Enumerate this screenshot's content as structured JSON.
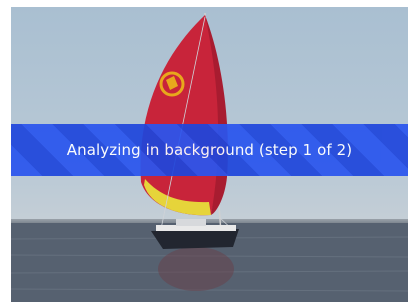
{
  "overlay": {
    "status_text": "Analyzing in background (step 1 of 2)"
  },
  "colors": {
    "banner_primary": "#2a55ee",
    "banner_secondary": "#1f46dc",
    "banner_text": "#ffffff",
    "sail_red": "#c8243a",
    "sail_yellow": "#e6d43a",
    "sky": "#b4c6d6",
    "water": "#566170"
  },
  "scene": {
    "subject": "sailboat-with-spinnaker",
    "icon": "sail-emblem-icon"
  }
}
